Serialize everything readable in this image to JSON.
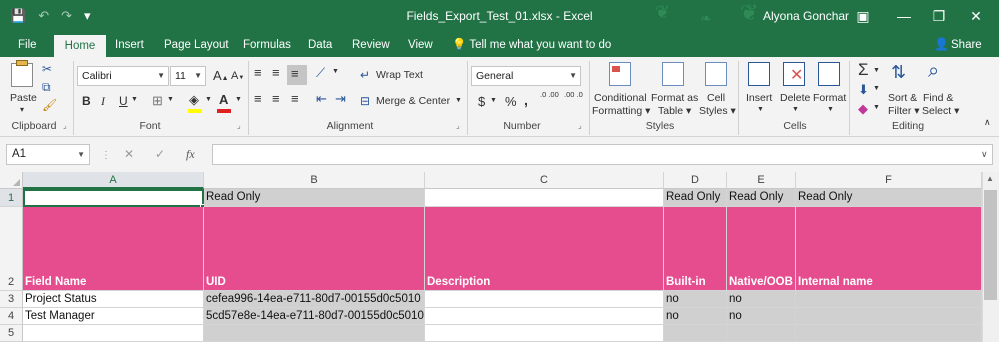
{
  "title_bar": {
    "filename": "Fields_Export_Test_01.xlsx",
    "separator": "-",
    "app": "Excel",
    "user": "Alyona Gonchar",
    "qat": [
      {
        "icon": "save-icon",
        "glyph": "💾"
      },
      {
        "icon": "undo-icon",
        "glyph": "↶"
      },
      {
        "icon": "redo-icon",
        "glyph": "↷"
      },
      {
        "icon": "customize-qat-icon",
        "glyph": "▾"
      }
    ],
    "controls": [
      {
        "name": "ribbon-display-options-button",
        "glyph": "▣"
      },
      {
        "name": "minimize-button",
        "glyph": "—"
      },
      {
        "name": "restore-button",
        "glyph": "❐"
      },
      {
        "name": "close-button",
        "glyph": "✕"
      }
    ]
  },
  "tabs": [
    "File",
    "Home",
    "Insert",
    "Page Layout",
    "Formulas",
    "Data",
    "Review",
    "View"
  ],
  "active_tab": "Home",
  "tell_me": "Tell me what you want to do",
  "share": "Share",
  "ribbon": {
    "clipboard": {
      "label": "Clipboard",
      "paste": "Paste"
    },
    "font": {
      "label": "Font",
      "name": "Calibri",
      "size": "11",
      "bold": "B",
      "italic": "I",
      "underline": "U",
      "grow": "A",
      "shrink": "A"
    },
    "alignment": {
      "label": "Alignment",
      "wrap": "Wrap Text",
      "merge": "Merge & Center"
    },
    "number": {
      "label": "Number",
      "format": "General",
      "currency": "$",
      "percent": "%",
      "comma": ",",
      "inc": ".0 .00",
      "dec": ".00 .0"
    },
    "styles": {
      "label": "Styles",
      "conditional_1": "Conditional",
      "conditional_2": "Formatting",
      "format_table_1": "Format as",
      "format_table_2": "Table",
      "cell_styles_1": "Cell",
      "cell_styles_2": "Styles"
    },
    "cells": {
      "label": "Cells",
      "insert": "Insert",
      "delete": "Delete",
      "format": "Format"
    },
    "editing": {
      "label": "Editing",
      "sum": "Σ",
      "sort_1": "Sort &",
      "sort_2": "Filter",
      "find_1": "Find &",
      "find_2": "Select"
    }
  },
  "formula_bar": {
    "name_box": "A1",
    "fx": "fx",
    "value": ""
  },
  "columns": [
    "A",
    "B",
    "C",
    "D",
    "E",
    "F"
  ],
  "rows": [
    "1",
    "2",
    "3",
    "4",
    "5"
  ],
  "sheet": {
    "row1": {
      "A": "",
      "B": "Read Only",
      "C": "",
      "D": "Read Only",
      "E": "Read Only",
      "F": "Read Only"
    },
    "row2": {
      "A": "Field Name",
      "B": "UID",
      "C": "Description",
      "D": "Built-in",
      "E": "Native/OOB",
      "F": "Internal name"
    },
    "row3": {
      "A": "Project Status",
      "B": "cefea996-14ea-e711-80d7-00155d0c5010",
      "C": "",
      "D": "no",
      "E": "no",
      "F": ""
    },
    "row4": {
      "A": "Test Manager",
      "B": "5cd57e8e-14ea-e711-80d7-00155d0c5010",
      "C": "",
      "D": "no",
      "E": "no",
      "F": ""
    }
  },
  "colors": {
    "excel_green": "#217346",
    "header_pink": "#e64d8f",
    "readonly_gray": "#d0d0d0"
  }
}
